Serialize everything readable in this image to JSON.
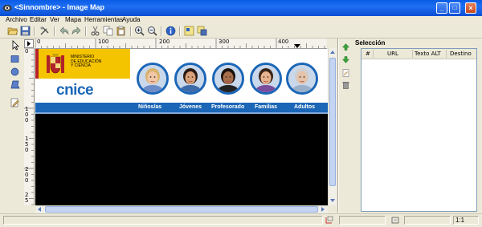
{
  "window": {
    "title": "<Sinnombre> - Image Map",
    "buttons": {
      "minimize": "_",
      "maximize": "□",
      "close": "×"
    }
  },
  "menu": [
    "Archivo",
    "Editar",
    "Ver",
    "Mapa",
    "Herramientas",
    "Ayuda"
  ],
  "toolbar": {
    "icons": [
      "open-icon",
      "save-icon",
      "preferences-icon",
      "undo-icon",
      "redo-icon",
      "cut-icon",
      "copy-icon",
      "paste-icon",
      "zoom-in-icon",
      "zoom-out-icon",
      "info-icon",
      "grid-icon",
      "settings-icon"
    ]
  },
  "tools": [
    "pointer-tool-icon",
    "rectangle-tool-icon",
    "circle-tool-icon",
    "polygon-tool-icon",
    "edit-tool-icon"
  ],
  "rulers": {
    "top_labels": [
      "0",
      "100",
      "200",
      "300",
      "400"
    ],
    "left_labels": [
      "0",
      "1",
      "0",
      "0",
      "1",
      "5",
      "0",
      "2",
      "0",
      "0",
      "2",
      "5"
    ]
  },
  "banner": {
    "ministry_lines": [
      "MINISTERIO",
      "DE EDUCACIÓN",
      "Y CIENCIA"
    ],
    "logo_text": "cnice",
    "nav_items": [
      "Niños/as",
      "Jóvenes",
      "Profesorado",
      "Familias",
      "Adultos"
    ],
    "colors": {
      "nav_bar": "#1b66b7",
      "yellow": "#f5c400",
      "red": "#b2232a",
      "circle_border": "#1b66b7"
    }
  },
  "selection_panel": {
    "title": "Selección",
    "columns": [
      "#",
      "URL",
      "Texto ALT",
      "Destino"
    ]
  },
  "status": {
    "zoom": "1:1"
  }
}
